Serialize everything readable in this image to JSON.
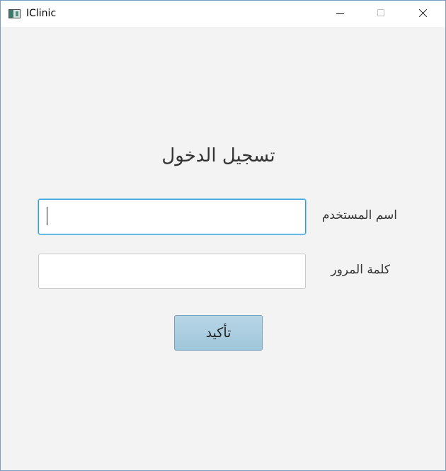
{
  "window": {
    "title": "IClinic",
    "icon": "app-window-icon",
    "controls": [
      "minimize-icon",
      "maximize-icon",
      "close-icon"
    ]
  },
  "login": {
    "heading": "تسجيل الدخول",
    "username_label": "اسم المستخدم",
    "username_value": "",
    "password_label": "كلمة المرور",
    "password_value": "",
    "confirm_label": "تأكيد"
  },
  "colors": {
    "focus_border": "#2a9fd8",
    "button_fill": "#a9cde0",
    "background": "#f3f3f3"
  }
}
